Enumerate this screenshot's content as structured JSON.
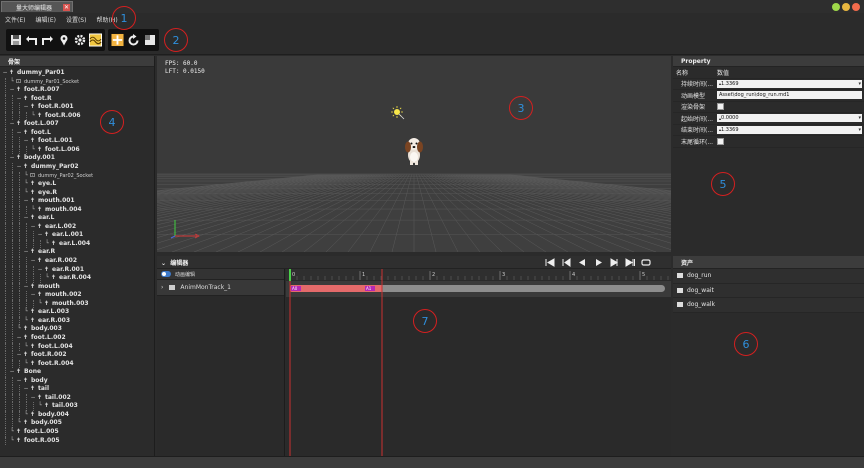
{
  "window": {
    "tab_title": "量大师编辑器",
    "tab_close": "✕",
    "colors": {
      "min": "#9fd84a",
      "max": "#e9b740",
      "close": "#f26b4c"
    }
  },
  "menu": [
    "文件(E)",
    "编辑(E)",
    "设置(S)",
    "帮助(H)"
  ],
  "toolbar": {
    "group1": [
      "save-icon",
      "undo-icon",
      "redo-icon",
      "pin-icon",
      "gear-icon",
      "wave-icon"
    ],
    "group2": [
      "transform-icon",
      "rotate-icon",
      "scale-icon"
    ]
  },
  "callouts": [
    "1",
    "2",
    "3",
    "4",
    "5",
    "6",
    "7"
  ],
  "skeleton": {
    "title": "骨架",
    "nodes": [
      {
        "label": "dummy_Par01",
        "depth": 0,
        "toggle": "−",
        "icon": "bone"
      },
      {
        "label": "dummy_Par01_Socket",
        "depth": 1,
        "toggle": "",
        "icon": "socket"
      },
      {
        "label": "foot.R.007",
        "depth": 1,
        "toggle": "−",
        "icon": "bone"
      },
      {
        "label": "foot.R",
        "depth": 2,
        "toggle": "−",
        "icon": "bone"
      },
      {
        "label": "foot.R.001",
        "depth": 3,
        "toggle": "−",
        "icon": "bone"
      },
      {
        "label": "foot.R.006",
        "depth": 4,
        "toggle": "",
        "icon": "bone"
      },
      {
        "label": "foot.L.007",
        "depth": 1,
        "toggle": "−",
        "icon": "bone"
      },
      {
        "label": "foot.L",
        "depth": 2,
        "toggle": "−",
        "icon": "bone"
      },
      {
        "label": "foot.L.001",
        "depth": 3,
        "toggle": "−",
        "icon": "bone"
      },
      {
        "label": "foot.L.006",
        "depth": 4,
        "toggle": "",
        "icon": "bone"
      },
      {
        "label": "body.001",
        "depth": 1,
        "toggle": "−",
        "icon": "bone"
      },
      {
        "label": "dummy_Par02",
        "depth": 2,
        "toggle": "−",
        "icon": "bone"
      },
      {
        "label": "dummy_Par02_Socket",
        "depth": 3,
        "toggle": "",
        "icon": "socket"
      },
      {
        "label": "eye.L",
        "depth": 3,
        "toggle": "",
        "icon": "bone"
      },
      {
        "label": "eye.R",
        "depth": 3,
        "toggle": "",
        "icon": "bone"
      },
      {
        "label": "mouth.001",
        "depth": 3,
        "toggle": "−",
        "icon": "bone"
      },
      {
        "label": "mouth.004",
        "depth": 4,
        "toggle": "",
        "icon": "bone"
      },
      {
        "label": "ear.L",
        "depth": 3,
        "toggle": "−",
        "icon": "bone"
      },
      {
        "label": "ear.L.002",
        "depth": 4,
        "toggle": "−",
        "icon": "bone"
      },
      {
        "label": "ear.L.001",
        "depth": 5,
        "toggle": "−",
        "icon": "bone"
      },
      {
        "label": "ear.L.004",
        "depth": 6,
        "toggle": "",
        "icon": "bone"
      },
      {
        "label": "ear.R",
        "depth": 3,
        "toggle": "−",
        "icon": "bone"
      },
      {
        "label": "ear.R.002",
        "depth": 4,
        "toggle": "−",
        "icon": "bone"
      },
      {
        "label": "ear.R.001",
        "depth": 5,
        "toggle": "−",
        "icon": "bone"
      },
      {
        "label": "ear.R.004",
        "depth": 6,
        "toggle": "",
        "icon": "bone"
      },
      {
        "label": "mouth",
        "depth": 3,
        "toggle": "−",
        "icon": "bone"
      },
      {
        "label": "mouth.002",
        "depth": 4,
        "toggle": "−",
        "icon": "bone"
      },
      {
        "label": "mouth.003",
        "depth": 5,
        "toggle": "",
        "icon": "bone"
      },
      {
        "label": "ear.L.003",
        "depth": 3,
        "toggle": "",
        "icon": "bone"
      },
      {
        "label": "ear.R.003",
        "depth": 3,
        "toggle": "",
        "icon": "bone"
      },
      {
        "label": "body.003",
        "depth": 2,
        "toggle": "",
        "icon": "bone"
      },
      {
        "label": "foot.L.002",
        "depth": 2,
        "toggle": "−",
        "icon": "bone"
      },
      {
        "label": "foot.L.004",
        "depth": 3,
        "toggle": "",
        "icon": "bone"
      },
      {
        "label": "foot.R.002",
        "depth": 2,
        "toggle": "−",
        "icon": "bone"
      },
      {
        "label": "foot.R.004",
        "depth": 3,
        "toggle": "",
        "icon": "bone"
      },
      {
        "label": "Bone",
        "depth": 1,
        "toggle": "−",
        "icon": "bone"
      },
      {
        "label": "body",
        "depth": 2,
        "toggle": "−",
        "icon": "bone"
      },
      {
        "label": "tail",
        "depth": 3,
        "toggle": "−",
        "icon": "bone"
      },
      {
        "label": "tail.002",
        "depth": 4,
        "toggle": "−",
        "icon": "bone"
      },
      {
        "label": "tail.003",
        "depth": 5,
        "toggle": "",
        "icon": "bone"
      },
      {
        "label": "body.004",
        "depth": 3,
        "toggle": "",
        "icon": "bone"
      },
      {
        "label": "body.005",
        "depth": 2,
        "toggle": "",
        "icon": "bone"
      },
      {
        "label": "foot.L.005",
        "depth": 1,
        "toggle": "",
        "icon": "bone"
      },
      {
        "label": "foot.R.005",
        "depth": 1,
        "toggle": "",
        "icon": "bone"
      }
    ]
  },
  "viewport": {
    "fps": "FPS: 60.0",
    "lft": "LFT: 0.0150"
  },
  "property": {
    "title": "Property",
    "col_name": "名称",
    "col_value": "数值",
    "rows": [
      {
        "name": "持续时间(...",
        "type": "num",
        "value": "1.3369"
      },
      {
        "name": "动画模型",
        "type": "text",
        "value": "Asset\\dog_run\\dog_run.md1"
      },
      {
        "name": "渲染骨架",
        "type": "check",
        "value": ""
      },
      {
        "name": "起始时间(...",
        "type": "num",
        "value": "0.0000"
      },
      {
        "name": "结束时间(...",
        "type": "num",
        "value": "1.3369"
      },
      {
        "name": "末尾循环(...",
        "type": "check",
        "value": ""
      }
    ]
  },
  "assets": {
    "title": "资产",
    "items": [
      "dog_run",
      "dog_wait",
      "dog_walk"
    ]
  },
  "editor": {
    "title": "编辑器",
    "playback": [
      "skip-start-icon",
      "prev-key-icon",
      "step-back-icon",
      "play-icon",
      "step-forward-icon",
      "skip-end-icon",
      "loop-icon"
    ],
    "toggle_label": "动画编辑",
    "track_label": "AnimMonTrack_1",
    "ruler_labels": [
      "0",
      "1",
      "2",
      "3",
      "4",
      "5",
      "6"
    ],
    "clip_labels": [
      "A0",
      "A1"
    ]
  }
}
